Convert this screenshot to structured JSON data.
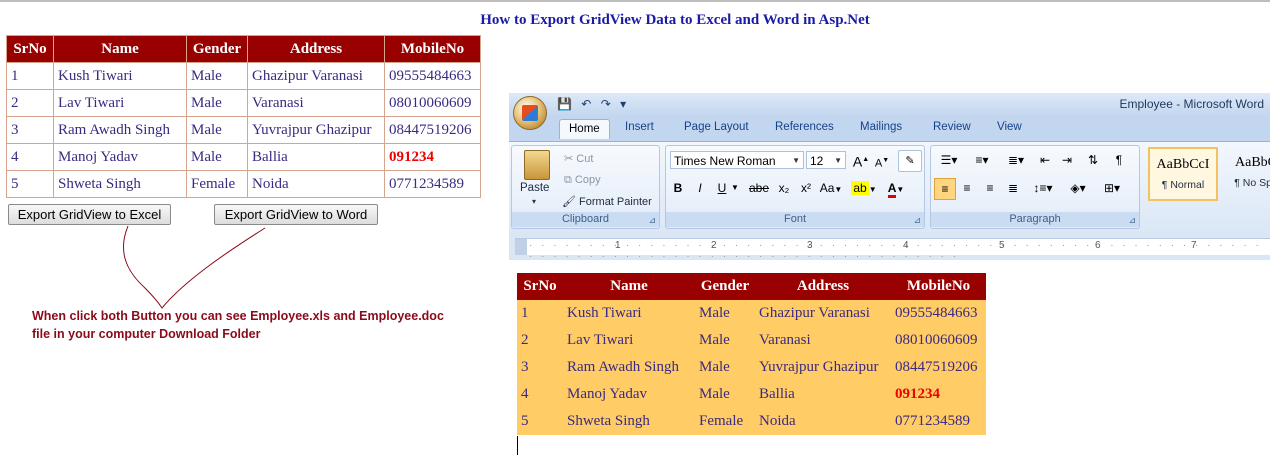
{
  "page": {
    "title": "How to Export GridView Data to Excel and Word in Asp.Net"
  },
  "grid": {
    "columns": [
      "SrNo",
      "Name",
      "Gender",
      "Address",
      "MobileNo"
    ],
    "rows": [
      [
        "1",
        "Kush Tiwari",
        "Male",
        "Ghazipur Varanasi",
        "09555484663"
      ],
      [
        "2",
        "Lav Tiwari",
        "Male",
        "Varanasi",
        "08010060609"
      ],
      [
        "3",
        "Ram Awadh Singh",
        "Male",
        "Yuvrajpur Ghazipur",
        "08447519206"
      ],
      [
        "4",
        "Manoj Yadav",
        "Male",
        "Ballia",
        "091234"
      ],
      [
        "5",
        "Shweta Singh",
        "Female",
        "Noida",
        "0771234589"
      ]
    ]
  },
  "buttons": {
    "excel": "Export GridView to Excel",
    "word": "Export GridView to Word"
  },
  "note": {
    "line1": "When click both Button  you can see Employee.xls and Employee.doc",
    "line2": "file in your computer Download Folder"
  },
  "word": {
    "window_title": "Employee - Microsoft Word",
    "tabs": [
      "Home",
      "Insert",
      "Page Layout",
      "References",
      "Mailings",
      "Review",
      "View"
    ],
    "clipboard": {
      "paste": "Paste",
      "cut": "Cut",
      "copy": "Copy",
      "format_painter": "Format Painter",
      "label": "Clipboard"
    },
    "font": {
      "name": "Times New Roman",
      "size": "12",
      "label": "Font",
      "bold": "B",
      "italic": "I",
      "underline": "U",
      "strike": "abe",
      "subscript": "x₂",
      "superscript": "x²",
      "change_case": "Aa",
      "grow": "A",
      "shrink": "A"
    },
    "paragraph": {
      "label": "Paragraph"
    },
    "styles": [
      {
        "sample": "AaBbCcI",
        "name": "¶ Normal"
      },
      {
        "sample": "AaBbC",
        "name": "¶ No Spa"
      }
    ],
    "ruler_numbers": [
      "1",
      "2",
      "3",
      "4",
      "5",
      "6",
      "7"
    ]
  },
  "colors": {
    "header_bg": "#990000",
    "word_row_bg": "#ffcc66",
    "highlight_value": "#ee0000",
    "title_blue": "#1a1aa6",
    "note_color": "#8b0a1a"
  }
}
